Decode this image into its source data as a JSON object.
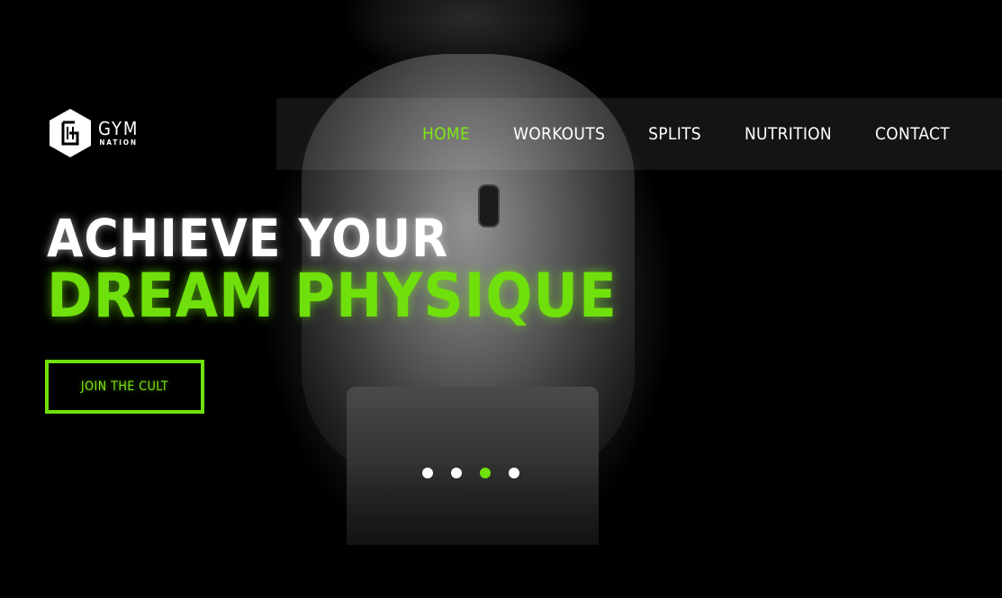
{
  "brand": {
    "line1": "GYM",
    "line2": "NATION"
  },
  "nav": {
    "items": [
      {
        "label": "HOME",
        "active": true
      },
      {
        "label": "WORKOUTS",
        "active": false
      },
      {
        "label": "SPLITS",
        "active": false
      },
      {
        "label": "NUTRITION",
        "active": false
      },
      {
        "label": "CONTACT",
        "active": false
      }
    ]
  },
  "hero": {
    "line1": "ACHIEVE YOUR",
    "line2": "DREAM PHYSIQUE",
    "cta_label": "JOIN THE CULT"
  },
  "carousel": {
    "slide_count": 4,
    "active_index": 2
  },
  "colors": {
    "accent": "#6fe00b",
    "background": "#000000",
    "text": "#ffffff"
  }
}
